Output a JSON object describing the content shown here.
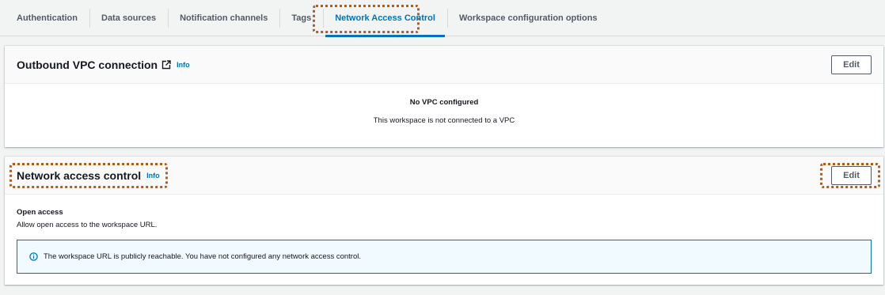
{
  "tabs": [
    {
      "label": "Authentication",
      "active": false
    },
    {
      "label": "Data sources",
      "active": false
    },
    {
      "label": "Notification channels",
      "active": false
    },
    {
      "label": "Tags",
      "active": false
    },
    {
      "label": "Network Access Control",
      "active": true
    },
    {
      "label": "Workspace configuration options",
      "active": false
    }
  ],
  "vpc_panel": {
    "title": "Outbound VPC connection",
    "title_icon": "external-link-icon",
    "info": "Info",
    "edit_label": "Edit",
    "empty_title": "No VPC configured",
    "empty_desc": "This workspace is not connected to a VPC"
  },
  "nac_panel": {
    "title": "Network access control",
    "info": "Info",
    "edit_label": "Edit",
    "open_title": "Open access",
    "open_desc": "Allow open access to the workspace URL.",
    "alert_icon": "info-circle-icon",
    "alert_text": "The workspace URL is publicly reachable. You have not configured any network access control."
  },
  "colors": {
    "accent": "#0073bb",
    "highlight": "#b35b1f",
    "alert_bg": "#f1faff"
  }
}
